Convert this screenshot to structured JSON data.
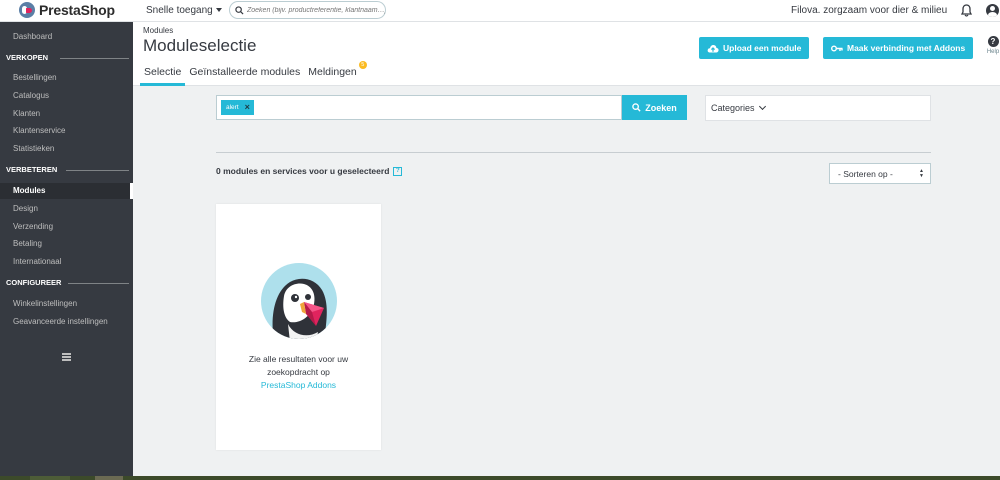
{
  "topbar": {
    "brand": "PrestaShop",
    "quick_access": "Snelle toegang",
    "search_placeholder": "Zoeken (bijv. productreferentie, klantnaam…)",
    "shop_name": "Filova. zorgzaam voor dier & milieu"
  },
  "sidebar": {
    "dashboard": "Dashboard",
    "sections": [
      {
        "title": "VERKOPEN",
        "items": [
          "Bestellingen",
          "Catalogus",
          "Klanten",
          "Klantenservice",
          "Statistieken"
        ]
      },
      {
        "title": "VERBETEREN",
        "items": [
          "Modules",
          "Design",
          "Verzending",
          "Betaling",
          "Internationaal"
        ]
      },
      {
        "title": "CONFIGUREER",
        "items": [
          "Winkelinstellingen",
          "Geavanceerde instellingen"
        ]
      }
    ],
    "active_item": "Modules"
  },
  "header": {
    "breadcrumb": "Modules",
    "title": "Moduleselectie",
    "upload_button": "Upload een module",
    "connect_button": "Maak verbinding met Addons",
    "help_label": "Help",
    "tabs": [
      {
        "label": "Selectie",
        "active": true
      },
      {
        "label": "Geïnstalleerde modules",
        "active": false
      },
      {
        "label": "Meldingen",
        "active": false,
        "badge": "5"
      }
    ]
  },
  "search": {
    "tag": "alert",
    "button": "Zoeken",
    "categories": "Categories"
  },
  "results": {
    "count_text": "0 modules en services voor u geselecteerd",
    "sort_label": "- Sorteren op -"
  },
  "card": {
    "line1": "Zie alle resultaten voor uw",
    "line2": "zoekopdracht op",
    "link": "PrestaShop Addons"
  },
  "colors": {
    "accent": "#25b9d7",
    "sidebar": "#363a41",
    "badge": "#fbbb22"
  }
}
